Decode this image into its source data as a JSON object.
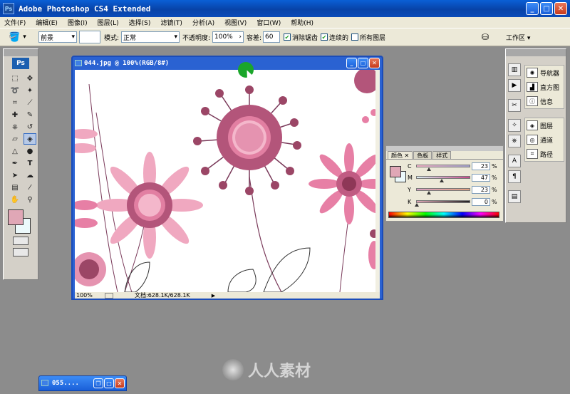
{
  "window": {
    "title": "Adobe Photoshop CS4 Extended",
    "app_icon": "Ps"
  },
  "menu": [
    "文件(F)",
    "编辑(E)",
    "图像(I)",
    "图层(L)",
    "选择(S)",
    "滤镜(T)",
    "分析(A)",
    "视图(V)",
    "窗口(W)",
    "帮助(H)"
  ],
  "options": {
    "fill_source": "前景",
    "mode_label": "模式:",
    "mode_value": "正常",
    "opacity_label": "不透明度:",
    "opacity_value": "100%",
    "tolerance_label": "容差:",
    "tolerance_value": "60",
    "anti_alias": "消除锯齿",
    "contiguous": "连续的",
    "all_layers": "所有图层",
    "workspace": "工作区 ▾"
  },
  "toolbox": {
    "logo": "Ps",
    "foreground_color": "#e0a7b6",
    "background_color": "#ecf9fb"
  },
  "document": {
    "title": "044.jpg @ 100%(RGB/8#)",
    "zoom": "100%",
    "doc_size": "文档:628.1K/628.1K"
  },
  "color_panel": {
    "tabs": [
      "颜色",
      "色板",
      "样式"
    ],
    "sliders": [
      {
        "label": "C",
        "value": "23",
        "unit": "%",
        "fraction": 0.23
      },
      {
        "label": "M",
        "value": "47",
        "unit": "%",
        "fraction": 0.47
      },
      {
        "label": "Y",
        "value": "23",
        "unit": "%",
        "fraction": 0.23
      },
      {
        "label": "K",
        "value": "0",
        "unit": "%",
        "fraction": 0.0
      }
    ]
  },
  "dock": {
    "group1": [
      "导航器",
      "直方图",
      "信息"
    ],
    "group2": [
      "图层",
      "通道",
      "路径"
    ]
  },
  "minimized": {
    "title": "055...."
  },
  "watermark": "人人素材"
}
